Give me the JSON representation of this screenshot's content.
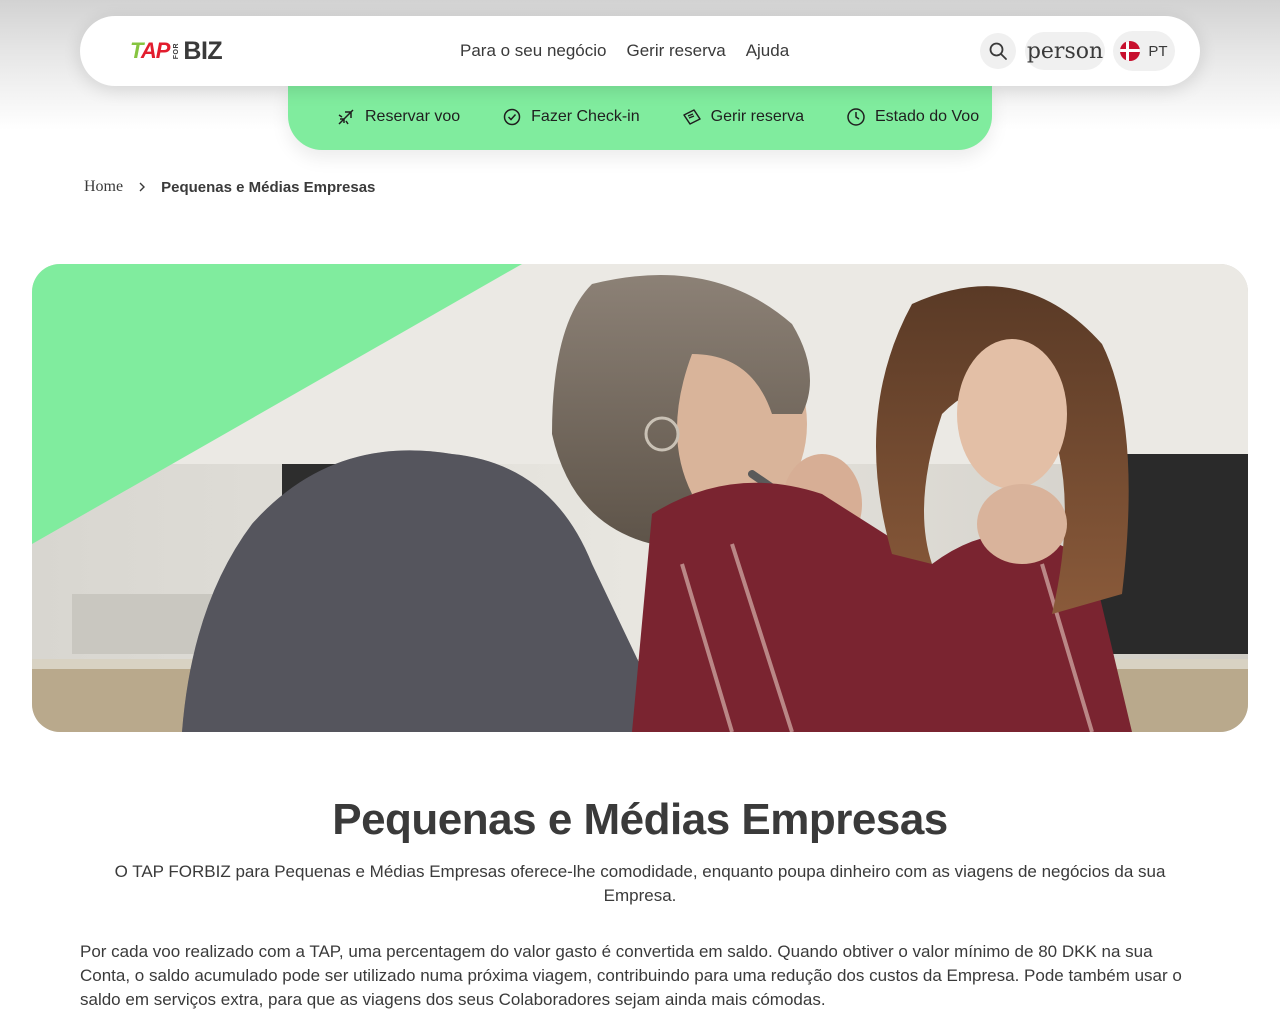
{
  "header": {
    "logo": {
      "tap": "TAP",
      "for": "FOR",
      "biz": "BIZ"
    },
    "nav": [
      "Para o seu negócio",
      "Gerir reserva",
      "Ajuda"
    ],
    "search_icon": "search-icon",
    "person_label": "person",
    "language": {
      "code": "PT",
      "flag": "denmark-flag"
    }
  },
  "quick_actions": [
    {
      "label": "Reservar voo",
      "icon": "plane-icon"
    },
    {
      "label": "Fazer Check-in",
      "icon": "check-circle-icon"
    },
    {
      "label": "Gerir reserva",
      "icon": "ticket-icon"
    },
    {
      "label": "Estado do Voo",
      "icon": "clock-icon"
    }
  ],
  "breadcrumb": {
    "home": "Home",
    "current": "Pequenas e Médias Empresas"
  },
  "hero": {
    "image": "two-women-working-at-desk-photo",
    "accent_color": "#80ec9e"
  },
  "content": {
    "title": "Pequenas e Médias Empresas",
    "subtitle": "O TAP FORBIZ para Pequenas e Médias Empresas oferece-lhe comodidade, enquanto poupa dinheiro com as viagens de negócios da sua Empresa.",
    "body": "Por cada voo realizado com a TAP, uma percentagem do valor gasto é convertida em saldo. Quando obtiver o valor mínimo de 80 DKK na sua Conta, o saldo acumulado pode ser utilizado numa próxima viagem, contribuindo para uma redução dos custos da Empresa. Pode também usar o saldo em serviços extra, para que as viagens dos seus Colaboradores sejam ainda mais cómodas."
  },
  "colors": {
    "accent": "#80ec9e",
    "text": "#3a3a3a",
    "tap_green": "#86c440",
    "tap_red": "#e21d2e"
  }
}
